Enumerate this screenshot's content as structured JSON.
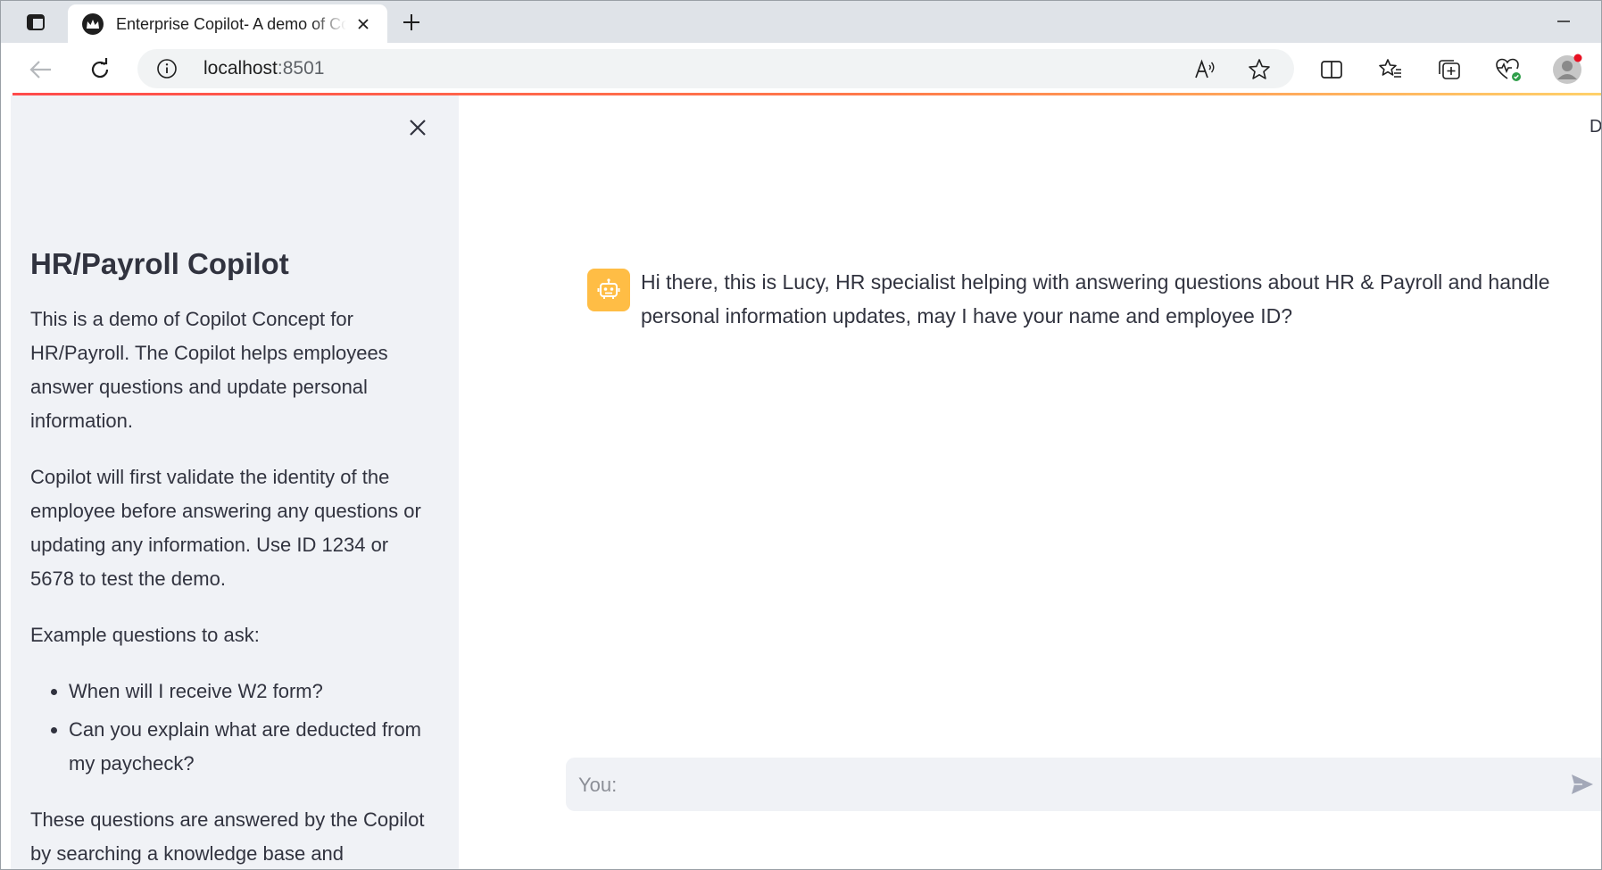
{
  "browser": {
    "tab": {
      "title": "Enterprise Copilot- A demo of Copilot",
      "favicon": "streamlit-crown-icon"
    },
    "address_bar": {
      "host": "localhost",
      "port": ":8501"
    },
    "icons": {
      "sidebar_toggle": "tab-actions-icon",
      "close_tab": "close-icon",
      "new_tab": "plus-icon",
      "minimize": "minimize-icon",
      "back": "back-arrow-icon",
      "refresh": "refresh-icon",
      "site_info": "info-icon",
      "read_aloud": "read-aloud-icon",
      "favorite": "star-icon",
      "split_screen": "split-screen-icon",
      "favorites": "favorites-icon",
      "collections": "collections-icon",
      "browser_essentials": "heart-pulse-icon",
      "profile": "avatar"
    },
    "colors": {
      "loading_bar_start": "#ff4b4b",
      "loading_bar_end": "#ffd16a"
    }
  },
  "sidebar": {
    "title": "HR/Payroll Copilot",
    "intro": "This is a demo of Copilot Concept for HR/Payroll. The Copilot helps employees answer questions and update personal information.",
    "validation": "Copilot will first validate the identity of the employee before answering any questions or updating any information. Use ID 1234 or 5678 to test the demo.",
    "examples_heading": "Example questions to ask:",
    "examples": [
      "When will I receive W2 form?",
      "Can you explain what are deducted from my paycheck?"
    ],
    "footer_text": "These questions are answered by the Copilot by searching a knowledge base and"
  },
  "main": {
    "deploy_label": "Deploy",
    "messages": [
      {
        "role": "assistant",
        "avatar": "robot-icon",
        "avatar_color": "#ffbd45",
        "text": "Hi there, this is Lucy, HR specialist helping with answering questions about HR & Payroll and handle personal information updates, may I have your name and employee ID?"
      }
    ],
    "chat_input": {
      "placeholder": "You:",
      "value": "",
      "send_icon": "send-icon"
    }
  }
}
